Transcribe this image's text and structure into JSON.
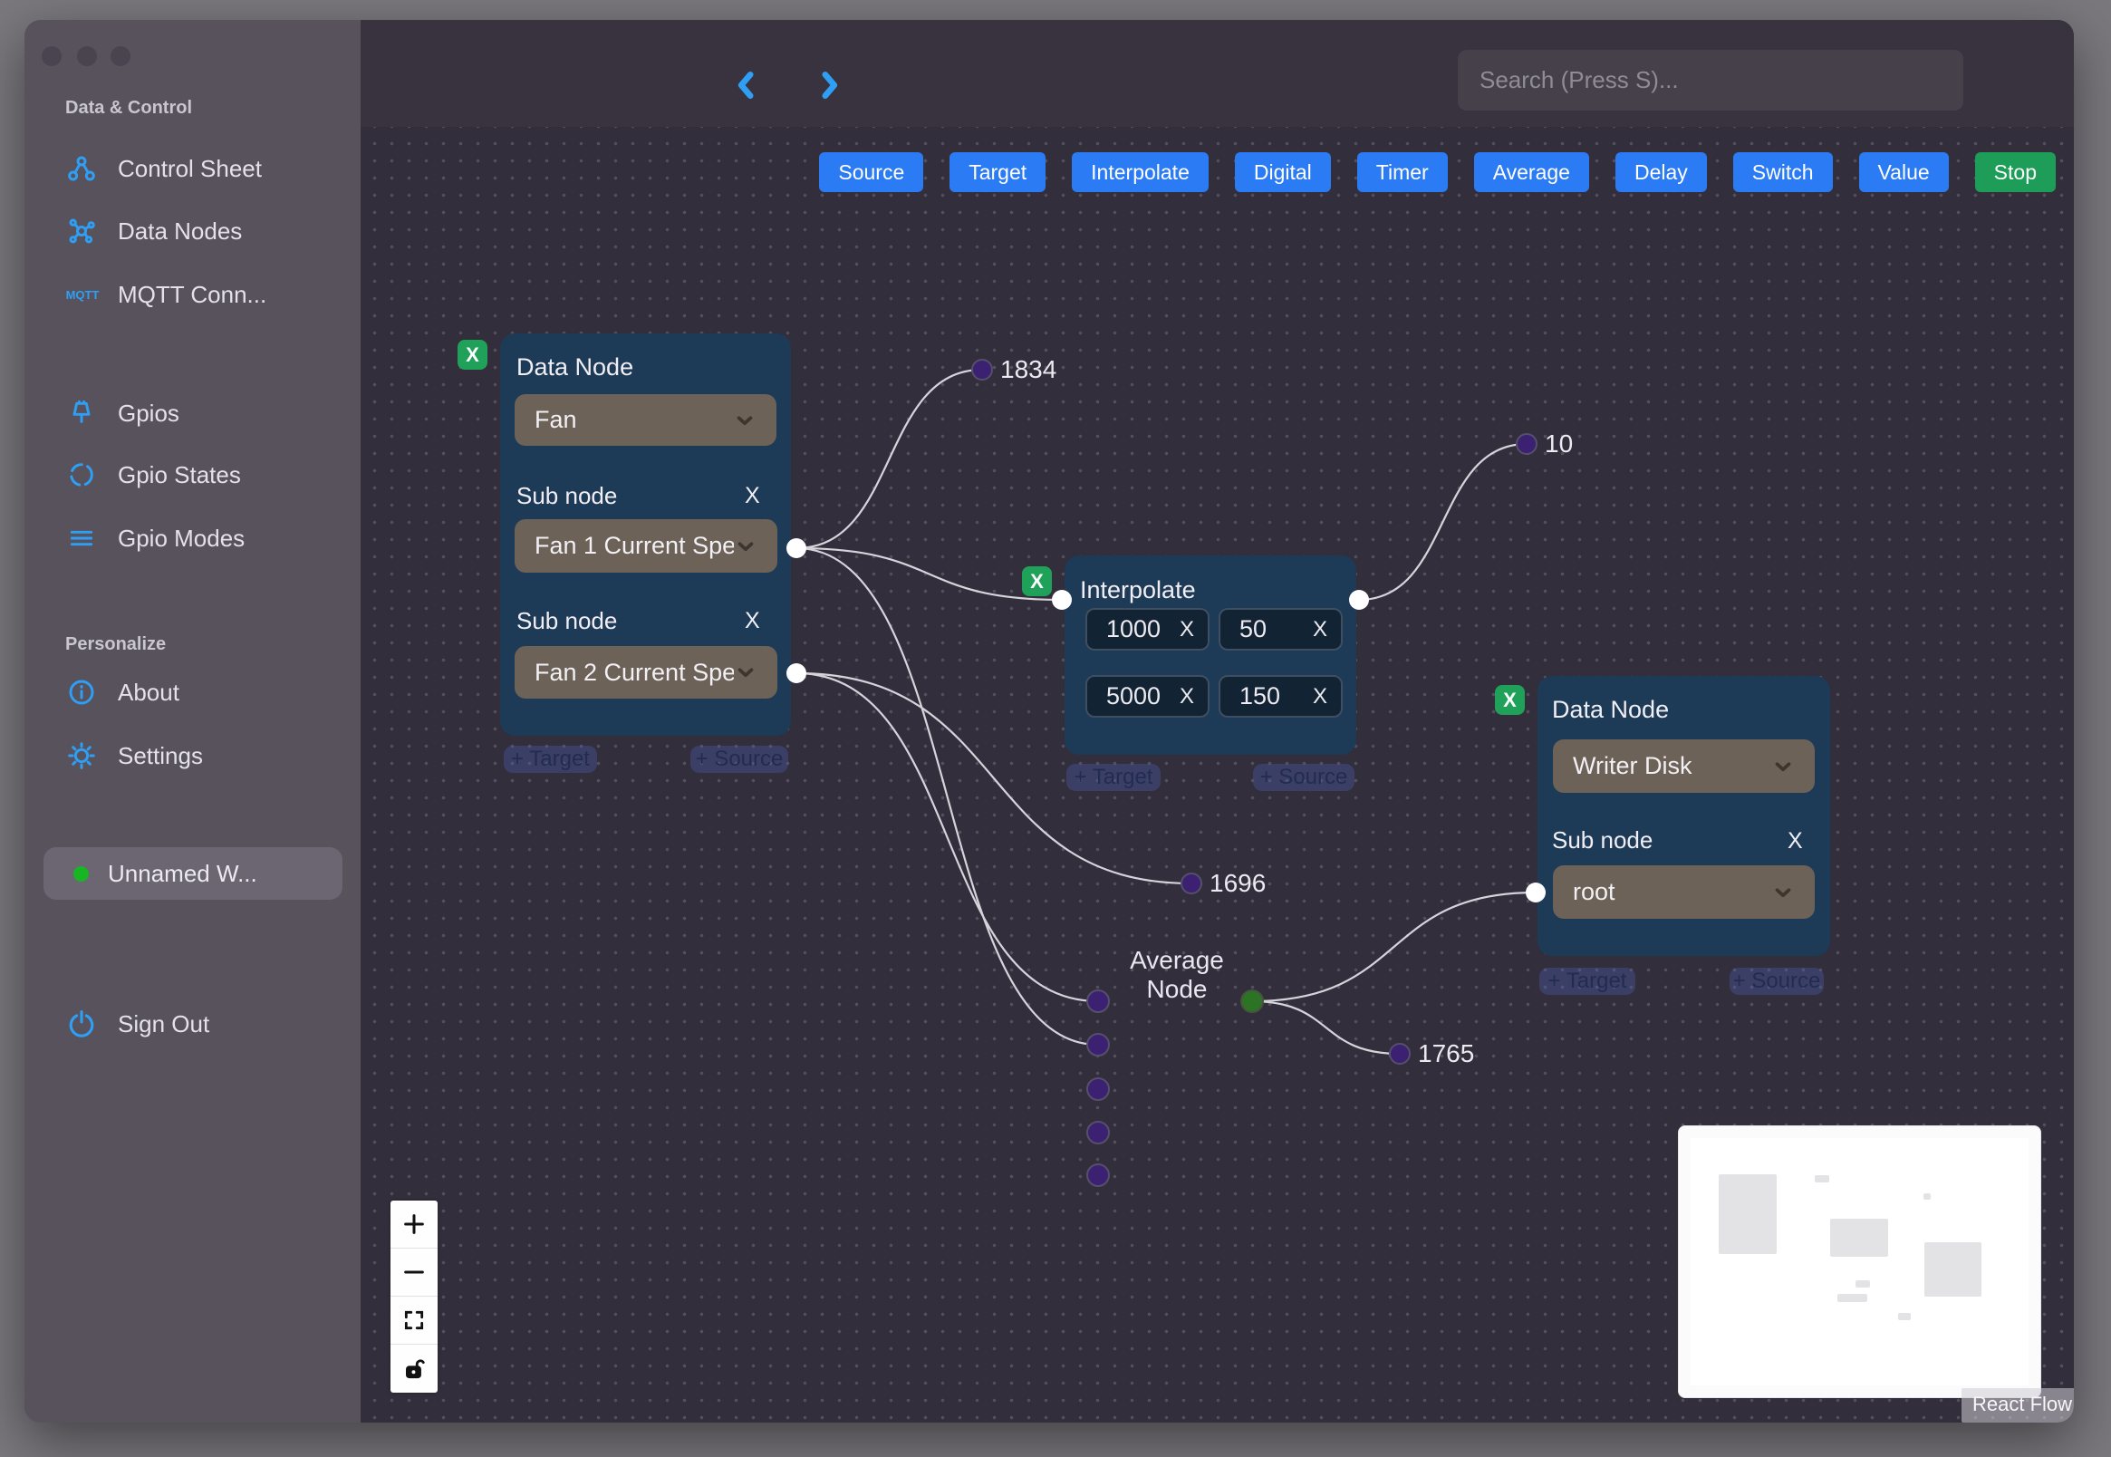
{
  "sidebar": {
    "section1": "Data & Control",
    "items1": [
      {
        "label": "Control Sheet",
        "icon": "org-chart-icon"
      },
      {
        "label": "Data Nodes",
        "icon": "graph-nodes-icon"
      },
      {
        "label": "MQTT Conn...",
        "icon": "mqtt-icon"
      }
    ],
    "items2": [
      {
        "label": "Gpios",
        "icon": "pin-icon"
      },
      {
        "label": "Gpio States",
        "icon": "dashed-circle-icon"
      },
      {
        "label": "Gpio Modes",
        "icon": "lines-icon"
      }
    ],
    "section2": "Personalize",
    "items3": [
      {
        "label": "About",
        "icon": "info-icon"
      },
      {
        "label": "Settings",
        "icon": "gear-icon"
      }
    ],
    "active": {
      "label": "Unnamed W...",
      "status_color": "#18b524"
    },
    "signout": "Sign Out"
  },
  "topbar": {
    "search_placeholder": "Search (Press S)..."
  },
  "toolbar": {
    "buttons": [
      {
        "label": "Source"
      },
      {
        "label": "Target"
      },
      {
        "label": "Interpolate"
      },
      {
        "label": "Digital"
      },
      {
        "label": "Timer"
      },
      {
        "label": "Average"
      },
      {
        "label": "Delay"
      },
      {
        "label": "Switch"
      },
      {
        "label": "Value"
      },
      {
        "label": "Stop"
      }
    ],
    "button_color": "#2b7bf4",
    "stop_color": "#1d9d57"
  },
  "flow": {
    "nodes": {
      "fan": {
        "title": "Data Node",
        "delete_x": "X",
        "select_value": "Fan",
        "sub1_label": "Sub node",
        "sub1_x": "X",
        "sub1_value": "Fan 1 Current Spe",
        "sub2_label": "Sub node",
        "sub2_x": "X",
        "sub2_value": "Fan 2 Current Spe",
        "add_target": "+ Target",
        "add_source": "+ Source"
      },
      "interpolate": {
        "title": "Interpolate",
        "delete_x": "X",
        "cells": [
          {
            "value": "1000",
            "x": "X"
          },
          {
            "value": "50",
            "x": "X"
          },
          {
            "value": "5000",
            "x": "X"
          },
          {
            "value": "150",
            "x": "X"
          }
        ],
        "add_target": "+ Target",
        "add_source": "+ Source"
      },
      "writer": {
        "title": "Data Node",
        "delete_x": "X",
        "select_value": "Writer Disk",
        "sub_label": "Sub node",
        "sub_x": "X",
        "sub_value": "root",
        "add_target": "+ Target",
        "add_source": "+ Source"
      },
      "average": {
        "title": "Average Node"
      }
    },
    "value_labels": [
      {
        "label": "1834"
      },
      {
        "label": "10"
      },
      {
        "label": "1696"
      },
      {
        "label": "1765"
      }
    ],
    "edges": [
      {
        "points": [
          879,
          605,
          1084,
          408
        ]
      },
      {
        "points": [
          879,
          605,
          1172,
          662
        ]
      },
      {
        "points": [
          879,
          605,
          1212,
          1153
        ]
      },
      {
        "points": [
          879,
          743,
          1315,
          975
        ]
      },
      {
        "points": [
          879,
          743,
          1212,
          1105
        ]
      },
      {
        "points": [
          1500,
          662,
          1685,
          490
        ]
      },
      {
        "points": [
          1382,
          1105,
          1695,
          985
        ]
      },
      {
        "points": [
          1382,
          1105,
          1545,
          1163
        ]
      }
    ]
  },
  "attribution": "React Flow",
  "colors": {
    "canvas_bg": "#332e3b",
    "node_bg": "#1d3a56",
    "select_bg": "#6c6257",
    "accent_blue": "#2f9ff5",
    "button_blue": "#2b7bf4",
    "stop_green": "#1d9d57",
    "delete_green": "#1fa15a",
    "purple_handle": "#3c2072",
    "green_handle": "#2c7326",
    "edge": "#d6d4db",
    "sidebar_bg": "#57525c"
  }
}
